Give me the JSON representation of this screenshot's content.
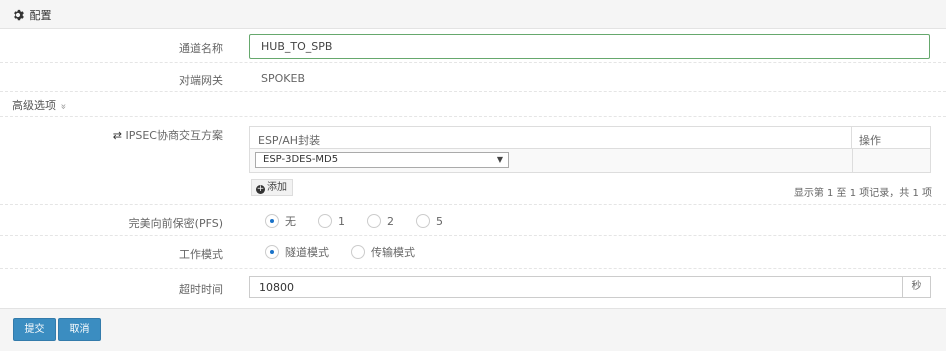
{
  "panel": {
    "title": "配置",
    "icon": "gear-icon"
  },
  "form": {
    "channel_name": {
      "label": "通道名称",
      "value": "HUB_TO_SPB"
    },
    "peer_gateway": {
      "label": "对端网关",
      "value": "SPOKEB"
    },
    "advanced": {
      "label": "高级选项",
      "chevron": "»"
    },
    "ipsec": {
      "label": "IPSEC协商交互方案",
      "icon": "exchange-icon",
      "columns": [
        "ESP/AH封装",
        "操作"
      ],
      "rows": [
        {
          "encapsulation": "ESP-3DES-MD5"
        }
      ],
      "add_label": "添加",
      "pager_info": "显示第 1 至 1 项记录，共 1 项"
    },
    "pfs": {
      "label": "完美向前保密(PFS)",
      "options": [
        "无",
        "1",
        "2",
        "5"
      ],
      "selected": "无"
    },
    "mode": {
      "label": "工作模式",
      "options": [
        "隧道模式",
        "传输模式"
      ],
      "selected": "隧道模式"
    },
    "timeout": {
      "label": "超时时间",
      "value": "10800",
      "unit": "秒"
    }
  },
  "footer": {
    "submit_label": "提交",
    "cancel_label": "取消"
  },
  "colors": {
    "primary": "#3b8dc1",
    "input_focus_border": "#66a86d",
    "radio_dot": "#1a73c8"
  }
}
